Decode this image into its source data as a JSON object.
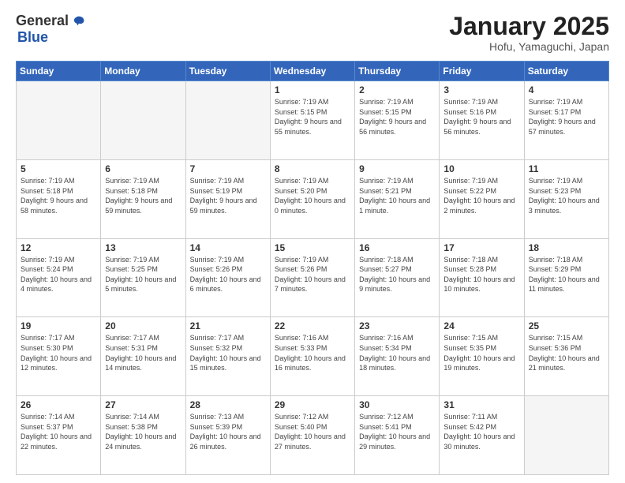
{
  "header": {
    "logo_general": "General",
    "logo_blue": "Blue",
    "month_title": "January 2025",
    "subtitle": "Hofu, Yamaguchi, Japan"
  },
  "days_of_week": [
    "Sunday",
    "Monday",
    "Tuesday",
    "Wednesday",
    "Thursday",
    "Friday",
    "Saturday"
  ],
  "weeks": [
    [
      {
        "num": "",
        "info": ""
      },
      {
        "num": "",
        "info": ""
      },
      {
        "num": "",
        "info": ""
      },
      {
        "num": "1",
        "info": "Sunrise: 7:19 AM\nSunset: 5:15 PM\nDaylight: 9 hours and 55 minutes."
      },
      {
        "num": "2",
        "info": "Sunrise: 7:19 AM\nSunset: 5:15 PM\nDaylight: 9 hours and 56 minutes."
      },
      {
        "num": "3",
        "info": "Sunrise: 7:19 AM\nSunset: 5:16 PM\nDaylight: 9 hours and 56 minutes."
      },
      {
        "num": "4",
        "info": "Sunrise: 7:19 AM\nSunset: 5:17 PM\nDaylight: 9 hours and 57 minutes."
      }
    ],
    [
      {
        "num": "5",
        "info": "Sunrise: 7:19 AM\nSunset: 5:18 PM\nDaylight: 9 hours and 58 minutes."
      },
      {
        "num": "6",
        "info": "Sunrise: 7:19 AM\nSunset: 5:18 PM\nDaylight: 9 hours and 59 minutes."
      },
      {
        "num": "7",
        "info": "Sunrise: 7:19 AM\nSunset: 5:19 PM\nDaylight: 9 hours and 59 minutes."
      },
      {
        "num": "8",
        "info": "Sunrise: 7:19 AM\nSunset: 5:20 PM\nDaylight: 10 hours and 0 minutes."
      },
      {
        "num": "9",
        "info": "Sunrise: 7:19 AM\nSunset: 5:21 PM\nDaylight: 10 hours and 1 minute."
      },
      {
        "num": "10",
        "info": "Sunrise: 7:19 AM\nSunset: 5:22 PM\nDaylight: 10 hours and 2 minutes."
      },
      {
        "num": "11",
        "info": "Sunrise: 7:19 AM\nSunset: 5:23 PM\nDaylight: 10 hours and 3 minutes."
      }
    ],
    [
      {
        "num": "12",
        "info": "Sunrise: 7:19 AM\nSunset: 5:24 PM\nDaylight: 10 hours and 4 minutes."
      },
      {
        "num": "13",
        "info": "Sunrise: 7:19 AM\nSunset: 5:25 PM\nDaylight: 10 hours and 5 minutes."
      },
      {
        "num": "14",
        "info": "Sunrise: 7:19 AM\nSunset: 5:26 PM\nDaylight: 10 hours and 6 minutes."
      },
      {
        "num": "15",
        "info": "Sunrise: 7:19 AM\nSunset: 5:26 PM\nDaylight: 10 hours and 7 minutes."
      },
      {
        "num": "16",
        "info": "Sunrise: 7:18 AM\nSunset: 5:27 PM\nDaylight: 10 hours and 9 minutes."
      },
      {
        "num": "17",
        "info": "Sunrise: 7:18 AM\nSunset: 5:28 PM\nDaylight: 10 hours and 10 minutes."
      },
      {
        "num": "18",
        "info": "Sunrise: 7:18 AM\nSunset: 5:29 PM\nDaylight: 10 hours and 11 minutes."
      }
    ],
    [
      {
        "num": "19",
        "info": "Sunrise: 7:17 AM\nSunset: 5:30 PM\nDaylight: 10 hours and 12 minutes."
      },
      {
        "num": "20",
        "info": "Sunrise: 7:17 AM\nSunset: 5:31 PM\nDaylight: 10 hours and 14 minutes."
      },
      {
        "num": "21",
        "info": "Sunrise: 7:17 AM\nSunset: 5:32 PM\nDaylight: 10 hours and 15 minutes."
      },
      {
        "num": "22",
        "info": "Sunrise: 7:16 AM\nSunset: 5:33 PM\nDaylight: 10 hours and 16 minutes."
      },
      {
        "num": "23",
        "info": "Sunrise: 7:16 AM\nSunset: 5:34 PM\nDaylight: 10 hours and 18 minutes."
      },
      {
        "num": "24",
        "info": "Sunrise: 7:15 AM\nSunset: 5:35 PM\nDaylight: 10 hours and 19 minutes."
      },
      {
        "num": "25",
        "info": "Sunrise: 7:15 AM\nSunset: 5:36 PM\nDaylight: 10 hours and 21 minutes."
      }
    ],
    [
      {
        "num": "26",
        "info": "Sunrise: 7:14 AM\nSunset: 5:37 PM\nDaylight: 10 hours and 22 minutes."
      },
      {
        "num": "27",
        "info": "Sunrise: 7:14 AM\nSunset: 5:38 PM\nDaylight: 10 hours and 24 minutes."
      },
      {
        "num": "28",
        "info": "Sunrise: 7:13 AM\nSunset: 5:39 PM\nDaylight: 10 hours and 26 minutes."
      },
      {
        "num": "29",
        "info": "Sunrise: 7:12 AM\nSunset: 5:40 PM\nDaylight: 10 hours and 27 minutes."
      },
      {
        "num": "30",
        "info": "Sunrise: 7:12 AM\nSunset: 5:41 PM\nDaylight: 10 hours and 29 minutes."
      },
      {
        "num": "31",
        "info": "Sunrise: 7:11 AM\nSunset: 5:42 PM\nDaylight: 10 hours and 30 minutes."
      },
      {
        "num": "",
        "info": ""
      }
    ]
  ]
}
